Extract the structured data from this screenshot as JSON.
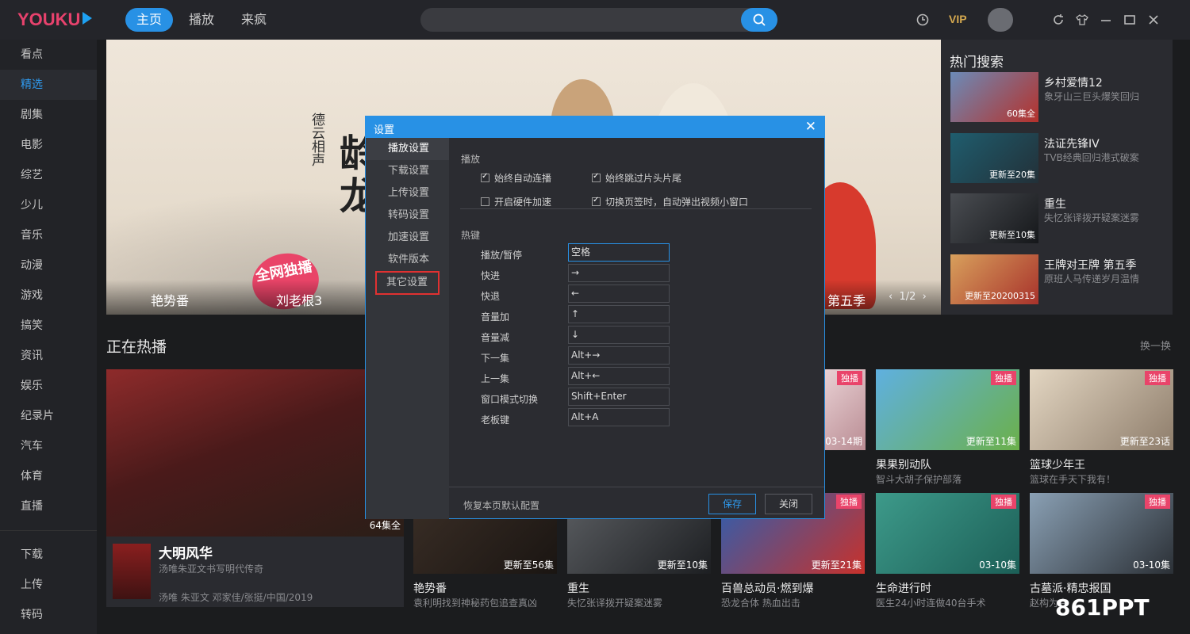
{
  "app": {
    "logo_text": "YOUKU"
  },
  "topnav": [
    {
      "label": "主页",
      "active": true
    },
    {
      "label": "播放",
      "active": false
    },
    {
      "label": "来疯",
      "active": false
    }
  ],
  "header": {
    "vip": "VIP"
  },
  "sidebar": {
    "items": [
      {
        "label": "看点"
      },
      {
        "label": "精选",
        "active": true
      },
      {
        "label": "剧集"
      },
      {
        "label": "电影"
      },
      {
        "label": "综艺"
      },
      {
        "label": "少儿"
      },
      {
        "label": "音乐"
      },
      {
        "label": "动漫"
      },
      {
        "label": "游戏"
      },
      {
        "label": "搞笑"
      },
      {
        "label": "资讯"
      },
      {
        "label": "娱乐"
      },
      {
        "label": "纪录片"
      },
      {
        "label": "汽车"
      },
      {
        "label": "体育"
      },
      {
        "label": "直播"
      }
    ],
    "bottom": [
      {
        "label": "下载"
      },
      {
        "label": "上传"
      },
      {
        "label": "转码"
      }
    ]
  },
  "banner": {
    "title_small": "德云相声",
    "title_big": "龄龙",
    "badge": "全网独播",
    "strip": [
      "艳势番",
      "刘老根3",
      "第五季"
    ],
    "pager": "1/2"
  },
  "hot": {
    "title": "热门搜索",
    "items": [
      {
        "name": "乡村爱情12",
        "desc": "象牙山三巨头爆笑回归",
        "tag": "60集全"
      },
      {
        "name": "法证先锋IV",
        "desc": "TVB经典回归港式破案",
        "tag": "更新至20集"
      },
      {
        "name": "重生",
        "desc": "失忆张译拨开疑案迷雾",
        "tag": "更新至10集"
      },
      {
        "name": "王牌对王牌 第五季",
        "desc": "原班人马传递岁月温情",
        "tag": "更新至20200315"
      }
    ]
  },
  "section": {
    "title": "正在热播",
    "refresh": "换一换"
  },
  "big_card": {
    "name": "大明风华",
    "desc": "汤唯朱亚文书写明代传奇",
    "cast": "汤唯 朱亚文 邓家佳/张挺/中国/2019",
    "ep": "64集全"
  },
  "cards_row1": [
    {
      "tag": "独播",
      "ep": "03-14期"
    },
    {
      "tag": "独播",
      "ep": "更新至11集",
      "name": "果果别动队",
      "desc": "智斗大胡子保护部落"
    },
    {
      "tag": "独播",
      "ep": "更新至23话",
      "name": "篮球少年王",
      "desc": "篮球在手天下我有！"
    }
  ],
  "cards_row2": [
    {
      "ep": "更新至56集",
      "name": "艳势番",
      "desc": "袁利明找到神秘药包追查真凶"
    },
    {
      "ep": "更新至10集",
      "name": "重生",
      "desc": "失忆张译拨开疑案迷雾"
    },
    {
      "tag": "独播",
      "ep": "更新至21集",
      "name": "百兽总动员·燃到爆",
      "desc": "恐龙合体 热血出击"
    },
    {
      "tag": "独播",
      "ep": "03-10集",
      "name": "生命进行时",
      "desc": "医生24小时连做40台手术"
    },
    {
      "tag": "独播",
      "ep": "03-10集",
      "name": "古墓派·精忠报国",
      "desc": "赵构为夺"
    }
  ],
  "watermark": "861PPT",
  "dialog": {
    "title": "设置",
    "close": "✕",
    "menu": [
      {
        "label": "播放设置",
        "active": true
      },
      {
        "label": "下载设置"
      },
      {
        "label": "上传设置"
      },
      {
        "label": "转码设置"
      },
      {
        "label": "加速设置"
      },
      {
        "label": "软件版本"
      },
      {
        "label": "其它设置",
        "highlight": true
      }
    ],
    "play_group": "播放",
    "checks": [
      {
        "label": "始终自动连播",
        "checked": true
      },
      {
        "label": "始终跳过片头片尾",
        "checked": true
      },
      {
        "label": "开启硬件加速",
        "checked": false
      },
      {
        "label": "切换页签时，自动弹出视频小窗口",
        "checked": true
      }
    ],
    "hotkey_group": "热键",
    "hotkeys": [
      {
        "label": "播放/暂停",
        "value": "空格"
      },
      {
        "label": "快进",
        "value": "→"
      },
      {
        "label": "快退",
        "value": "←"
      },
      {
        "label": "音量加",
        "value": "↑"
      },
      {
        "label": "音量减",
        "value": "↓"
      },
      {
        "label": "下一集",
        "value": "Alt+→"
      },
      {
        "label": "上一集",
        "value": "Alt+←"
      },
      {
        "label": "窗口模式切换",
        "value": "Shift+Enter"
      },
      {
        "label": "老板键",
        "value": "Alt+A"
      }
    ],
    "restore": "恢复本页默认配置",
    "save": "保存",
    "close_btn": "关闭"
  }
}
